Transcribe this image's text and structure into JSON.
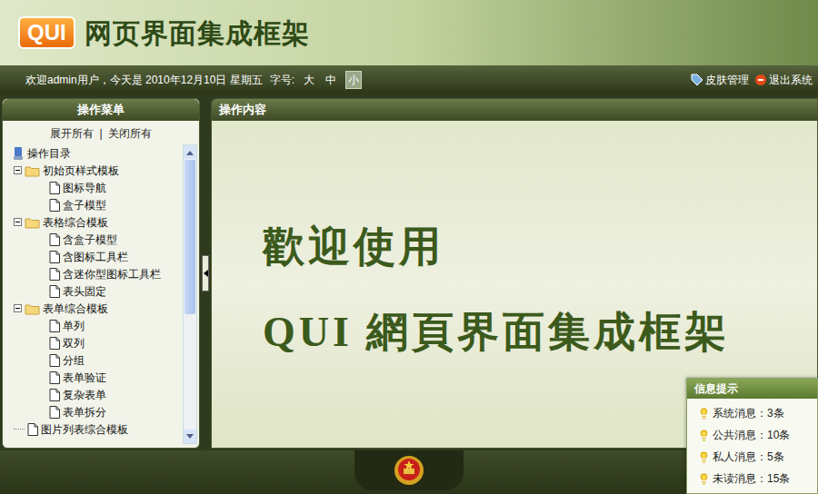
{
  "header": {
    "logo": "QUI",
    "title": "网页界面集成框架"
  },
  "topbar": {
    "welcome": "欢迎admin用户，今天是 2010年12月10日 星期五",
    "font_label": "字号:",
    "font_sizes": [
      {
        "label": "大",
        "selected": false
      },
      {
        "label": "中",
        "selected": false
      },
      {
        "label": "小",
        "selected": true
      }
    ],
    "links": [
      {
        "label": "皮肤管理",
        "kind": "skin"
      },
      {
        "label": "退出系统",
        "kind": "exit"
      }
    ]
  },
  "sidebar": {
    "title": "操作菜单",
    "expand_all": "展开所有",
    "separator": "|",
    "collapse_all": "关闭所有",
    "items": [
      {
        "label": "操作目录",
        "kind": "root",
        "level": 0,
        "expanded": true
      },
      {
        "label": "初始页样式模板",
        "kind": "folder",
        "level": 1,
        "expanded": true
      },
      {
        "label": "图标导航",
        "kind": "file",
        "level": 2,
        "expanded": false
      },
      {
        "label": "盒子模型",
        "kind": "file",
        "level": 2,
        "expanded": false
      },
      {
        "label": "表格综合模板",
        "kind": "folder",
        "level": 1,
        "expanded": true
      },
      {
        "label": "含盒子模型",
        "kind": "file",
        "level": 2,
        "expanded": false
      },
      {
        "label": "含图标工具栏",
        "kind": "file",
        "level": 2,
        "expanded": false
      },
      {
        "label": "含迷你型图标工具栏",
        "kind": "file",
        "level": 2,
        "expanded": false
      },
      {
        "label": "表头固定",
        "kind": "file",
        "level": 2,
        "expanded": false
      },
      {
        "label": "表单综合模板",
        "kind": "folder",
        "level": 1,
        "expanded": true
      },
      {
        "label": "单列",
        "kind": "file",
        "level": 2,
        "expanded": false
      },
      {
        "label": "双列",
        "kind": "file",
        "level": 2,
        "expanded": false
      },
      {
        "label": "分组",
        "kind": "file",
        "level": 2,
        "expanded": false
      },
      {
        "label": "表单验证",
        "kind": "file",
        "level": 2,
        "expanded": false
      },
      {
        "label": "复杂表单",
        "kind": "file",
        "level": 2,
        "expanded": false
      },
      {
        "label": "表单拆分",
        "kind": "file",
        "level": 2,
        "expanded": false
      },
      {
        "label": "图片列表综合模板",
        "kind": "file",
        "level": 1,
        "expanded": false
      }
    ]
  },
  "content": {
    "title": "操作内容",
    "welcome_lines": [
      "歡迎使用",
      "QUI 網頁界面集成框架"
    ]
  },
  "info_box": {
    "title": "信息提示",
    "items": [
      "系统消息：3条",
      "公共消息：10条",
      "私人消息：5条",
      "未读消息：15条"
    ]
  }
}
